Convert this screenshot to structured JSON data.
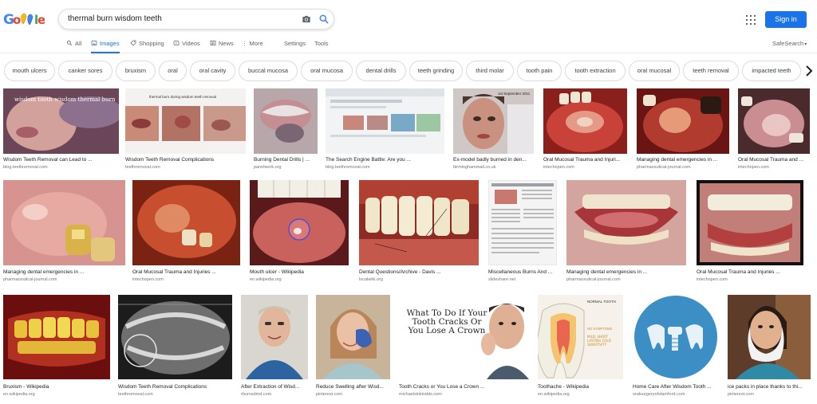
{
  "search": {
    "query": "thermal burn wisdom teeth"
  },
  "header": {
    "sign_in": "Sign in"
  },
  "tabs": [
    {
      "label": "All",
      "icon": "search-icon"
    },
    {
      "label": "Images",
      "icon": "image-icon",
      "active": true
    },
    {
      "label": "Shopping",
      "icon": "tag-icon"
    },
    {
      "label": "Videos",
      "icon": "play-icon"
    },
    {
      "label": "News",
      "icon": "newspaper-icon"
    },
    {
      "label": "More",
      "icon": "more-dots-icon"
    }
  ],
  "tools": {
    "settings": "Settings",
    "tools": "Tools",
    "safesearch": "SafeSearch"
  },
  "chips": [
    "mouth ulcers",
    "canker sores",
    "bruxism",
    "oral",
    "oral cavity",
    "buccal mucosa",
    "oral mucosa",
    "dental drills",
    "teeth grinding",
    "third molar",
    "tooth pain",
    "tooth extraction",
    "oral mucosal",
    "teeth removal",
    "impacted teeth"
  ],
  "results": [
    {
      "title": "Wisdom Teeth Removal can Lead to ...",
      "domain": "blog.teethremoval.com",
      "overlay": "wisdom tooth wisdom thermal burn"
    },
    {
      "title": "Wisdom Teeth Removal Complications",
      "domain": "teethremoval.com",
      "overlay": "thermal burn during wisdom teeth removal"
    },
    {
      "title": "Burning Dental Drills | ...",
      "domain": "panelwork.org"
    },
    {
      "title": "The Search Engine Battle: Are you ...",
      "domain": "blog.teethremoval.com"
    },
    {
      "title": "Ex-model badly burned in den...",
      "domain": "birminghammail.co.uk",
      "overlay": "1st September 2011"
    },
    {
      "title": "Oral Mucosal Trauma and Injuri...",
      "domain": "intechopen.com"
    },
    {
      "title": "Managing dental emergencies in ...",
      "domain": "pharmaceutical-journal.com"
    },
    {
      "title": "Oral Mucosal Trauma and ...",
      "domain": "intechopen.com"
    },
    {
      "title": "Managing dental emergencies in ...",
      "domain": "pharmaceutical-journal.com"
    },
    {
      "title": "Oral Mucosal Trauma and Injuries ...",
      "domain": "intechopen.com"
    },
    {
      "title": "Mouth ulcer - Wikipedia",
      "domain": "en.wikipedia.org"
    },
    {
      "title": "Dental Questions/Archive - Davis ...",
      "domain": "localwiki.org"
    },
    {
      "title": "Miscellaneous Burns And ...",
      "domain": "slideshare.net"
    },
    {
      "title": "Managing dental emergencies in ...",
      "domain": "pharmaceutical-journal.com"
    },
    {
      "title": "Oral Mucosal Trauma and Injuries ...",
      "domain": "intechopen.com"
    },
    {
      "title": "Bruxism - Wikipedia",
      "domain": "en.wikipedia.org"
    },
    {
      "title": "Wisdom Teeth Removal Complications",
      "domain": "teethremoval.com"
    },
    {
      "title": "After Extraction of Wisd...",
      "domain": "rburnsdmd.com"
    },
    {
      "title": "Reduce Swelling after Wisd...",
      "domain": "pinterest.com"
    },
    {
      "title": "Tooth Cracks or You Lose a Crown ...",
      "domain": "michaelsinkindds.com",
      "overlay": "What To Do If Your Tooth Cracks Or You Lose A Crown"
    },
    {
      "title": "Toothache - Wikipedia",
      "domain": "en.wikipedia.org",
      "overlay": "NORMAL TOOTH",
      "overlay2": "NO SYMPTOMS",
      "overlay3": "MILD, SHORT LASTING COLD SENSITIVITY"
    },
    {
      "title": "Home Care After Wisdom Tooth ...",
      "domain": "oralsurgeryofstamford.com"
    },
    {
      "title": "ice packs in place thanks to thi...",
      "domain": "pinterest.com"
    }
  ],
  "colors": {
    "accent": "#1a73e8",
    "chip_border": "#dadce0",
    "muted": "#70757a"
  }
}
